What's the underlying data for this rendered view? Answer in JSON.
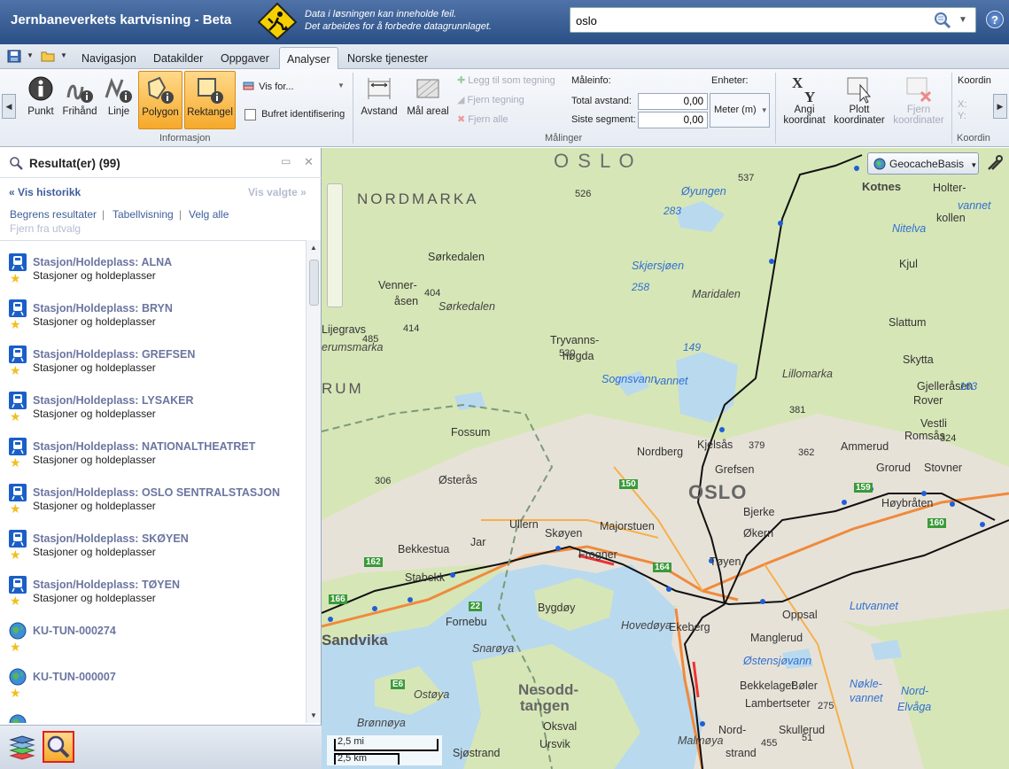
{
  "header": {
    "app_title": "Jernbaneverkets kartvisning - Beta",
    "warning_line1": "Data i løsningen kan inneholde feil.",
    "warning_line2": "Det arbeides for å forbedre datagrunnlaget.",
    "search_value": "oslo",
    "help_label": "?"
  },
  "tabs": [
    {
      "label": "Navigasjon"
    },
    {
      "label": "Datakilder"
    },
    {
      "label": "Oppgaver"
    },
    {
      "label": "Analyser"
    },
    {
      "label": "Norske tjenester"
    }
  ],
  "active_tab": "Analyser",
  "ribbon": {
    "informasjon": {
      "label": "Informasjon",
      "buttons": [
        {
          "label": "Punkt"
        },
        {
          "label": "Frihånd"
        },
        {
          "label": "Linje"
        },
        {
          "label": "Polygon"
        },
        {
          "label": "Rektangel"
        }
      ],
      "vis_for": "Vis for...",
      "bufret": "Bufret identifisering"
    },
    "malinger": {
      "label": "Målinger",
      "avstand": "Avstand",
      "mal_areal": "Mål areal",
      "legg_til": "Legg til som tegning",
      "fjern_tegning": "Fjern tegning",
      "fjern_alle": "Fjern alle",
      "maleinfo": "Måleinfo:",
      "enheter": "Enheter:",
      "total_label": "Total avstand:",
      "total_value": "0,00",
      "siste_label": "Siste segment:",
      "siste_value": "0,00",
      "unit": "Meter (m)"
    },
    "koordinater": {
      "label": "Koordin",
      "angi": [
        "Angi",
        "koordinat"
      ],
      "plott": [
        "Plott",
        "koordinater"
      ],
      "fjern": [
        "Fjern",
        "koordinater"
      ],
      "koordin_title": "Koordin",
      "x": "X:",
      "y": "Y:"
    }
  },
  "panel": {
    "title": "Resultat(er) (99)",
    "vis_historikk": "Vis historikk",
    "vis_valgte": "Vis valgte",
    "begrens": "Begrens resultater",
    "tabell": "Tabellvisning",
    "velg_alle": "Velg alle",
    "fjern": "Fjern fra utvalg",
    "results": [
      {
        "title": "Stasjon/Holdeplass: ALNA",
        "sub": "Stasjoner og holdeplasser",
        "icon": "train-icon"
      },
      {
        "title": "Stasjon/Holdeplass: BRYN",
        "sub": "Stasjoner og holdeplasser",
        "icon": "train-icon"
      },
      {
        "title": "Stasjon/Holdeplass: GREFSEN",
        "sub": "Stasjoner og holdeplasser",
        "icon": "train-icon"
      },
      {
        "title": "Stasjon/Holdeplass: LYSAKER",
        "sub": "Stasjoner og holdeplasser",
        "icon": "train-icon"
      },
      {
        "title": "Stasjon/Holdeplass: NATIONALTHEATRET",
        "sub": "Stasjoner og holdeplasser",
        "icon": "train-icon"
      },
      {
        "title": "Stasjon/Holdeplass: OSLO SENTRALSTASJON",
        "sub": "Stasjoner og holdeplasser",
        "icon": "train-icon"
      },
      {
        "title": "Stasjon/Holdeplass: SKØYEN",
        "sub": "Stasjoner og holdeplasser",
        "icon": "train-icon"
      },
      {
        "title": "Stasjon/Holdeplass: TØYEN",
        "sub": "Stasjoner og holdeplasser",
        "icon": "train-icon"
      },
      {
        "title": "KU-TUN-000274",
        "sub": "",
        "icon": "globe-icon"
      },
      {
        "title": "KU-TUN-000007",
        "sub": "",
        "icon": "globe-icon"
      }
    ]
  },
  "map": {
    "basemap": "GeocacheBasis",
    "scale_mi": "2,5 mi",
    "scale_km": "2,5 km",
    "labels": [
      {
        "t": "O S L O",
        "k": "big"
      },
      {
        "t": "NORDMARKA",
        "k": "region"
      },
      {
        "t": "Kotnes",
        "k": "place"
      },
      {
        "t": "Holter-",
        "k": "small"
      },
      {
        "t": "kollen",
        "k": "small"
      },
      {
        "t": "Nitelva",
        "k": "water"
      },
      {
        "t": "Kjul",
        "k": "small"
      },
      {
        "t": "Sørkedalen",
        "k": "small"
      },
      {
        "t": "Venner-",
        "k": "small"
      },
      {
        "t": "åsen",
        "k": "small"
      },
      {
        "t": "Sørkedalen",
        "k": "italic"
      },
      {
        "t": "Øyungen",
        "k": "water"
      },
      {
        "t": "Skjersjøen",
        "k": "water"
      },
      {
        "t": "Maridalen",
        "k": "italic"
      },
      {
        "t": "Tryvanns-",
        "k": "small"
      },
      {
        "t": "høgda",
        "k": "small"
      },
      {
        "t": "Sognsvann",
        "k": "water"
      },
      {
        "t": "Lillomarka",
        "k": "italic"
      },
      {
        "t": "Slattum",
        "k": "small"
      },
      {
        "t": "Skytta",
        "k": "small"
      },
      {
        "t": "Gjelleråsen",
        "k": "small"
      },
      {
        "t": "Rover",
        "k": "small"
      },
      {
        "t": "Romsås",
        "k": "small"
      },
      {
        "t": "Vestli",
        "k": "small"
      },
      {
        "t": "Ammerud",
        "k": "small"
      },
      {
        "t": "Grorud",
        "k": "small"
      },
      {
        "t": "Stovner",
        "k": "small"
      },
      {
        "t": "Fossum",
        "k": "small"
      },
      {
        "t": "Kjelsås",
        "k": "small"
      },
      {
        "t": "Nordberg",
        "k": "small"
      },
      {
        "t": "Grefsen",
        "k": "small"
      },
      {
        "t": "OSLO",
        "k": "city"
      },
      {
        "t": "Østerås",
        "k": "small"
      },
      {
        "t": "Bjerke",
        "k": "small"
      },
      {
        "t": "Økern",
        "k": "small"
      },
      {
        "t": "Høybråten",
        "k": "small"
      },
      {
        "t": "Ullern",
        "k": "small"
      },
      {
        "t": "Skøyen",
        "k": "small"
      },
      {
        "t": "Majorstuen",
        "k": "small"
      },
      {
        "t": "Frogner",
        "k": "small"
      },
      {
        "t": "Tøyen",
        "k": "small"
      },
      {
        "t": "Bekkestua",
        "k": "small"
      },
      {
        "t": "Jar",
        "k": "small"
      },
      {
        "t": "Stabekk",
        "k": "small"
      },
      {
        "t": "Fornebu",
        "k": "small"
      },
      {
        "t": "Bygdøy",
        "k": "small"
      },
      {
        "t": "Hovedøya",
        "k": "italic"
      },
      {
        "t": "Ekeberg",
        "k": "small"
      },
      {
        "t": "Oppsal",
        "k": "small"
      },
      {
        "t": "Lutvannet",
        "k": "water"
      },
      {
        "t": "Manglerud",
        "k": "small"
      },
      {
        "t": "Sandvika",
        "k": "town"
      },
      {
        "t": "Snarøya",
        "k": "italic"
      },
      {
        "t": "Østensjøvann",
        "k": "water"
      },
      {
        "t": "Bøler",
        "k": "small"
      },
      {
        "t": "Nøkle-",
        "k": "water"
      },
      {
        "t": "vannet",
        "k": "water"
      },
      {
        "t": "Nord-",
        "k": "water"
      },
      {
        "t": "Elvåga",
        "k": "water"
      },
      {
        "t": "Nesodd-",
        "k": "town2"
      },
      {
        "t": "tangen",
        "k": "town2"
      },
      {
        "t": "Ostøya",
        "k": "italic"
      },
      {
        "t": "Lambertseter",
        "k": "small"
      },
      {
        "t": "Skullerud",
        "k": "small"
      },
      {
        "t": "Bekkelaget",
        "k": "small"
      },
      {
        "t": "Nord-",
        "k": "small"
      },
      {
        "t": "strand",
        "k": "small"
      },
      {
        "t": "Oksval",
        "k": "small"
      },
      {
        "t": "Ursvik",
        "k": "small"
      },
      {
        "t": "Malmøya",
        "k": "italic"
      },
      {
        "t": "Brønnøya",
        "k": "italic"
      },
      {
        "t": "Sjøstrand",
        "k": "small"
      },
      {
        "t": "Lijegravs",
        "k": "small"
      },
      {
        "t": "erumsmarka",
        "k": "italic"
      },
      {
        "t": "RUM",
        "k": "region"
      },
      {
        "t": "526",
        "k": "num"
      },
      {
        "t": "537",
        "k": "num"
      },
      {
        "t": "283",
        "k": "waternum"
      },
      {
        "t": "258",
        "k": "waternum"
      },
      {
        "t": "404",
        "k": "num"
      },
      {
        "t": "414",
        "k": "num"
      },
      {
        "t": "485",
        "k": "num"
      },
      {
        "t": "530",
        "k": "num"
      },
      {
        "t": "149",
        "k": "waternum"
      },
      {
        "t": "381",
        "k": "num"
      },
      {
        "t": "379",
        "k": "num"
      },
      {
        "t": "362",
        "k": "num"
      },
      {
        "t": "324",
        "k": "num"
      },
      {
        "t": "306",
        "k": "num"
      },
      {
        "t": "150",
        "k": "road"
      },
      {
        "t": "159",
        "k": "road"
      },
      {
        "t": "160",
        "k": "road"
      },
      {
        "t": "162",
        "k": "road"
      },
      {
        "t": "164",
        "k": "road"
      },
      {
        "t": "166",
        "k": "road"
      },
      {
        "t": "22",
        "k": "road"
      },
      {
        "t": "163",
        "k": "waternum"
      },
      {
        "t": "275",
        "k": "num"
      },
      {
        "t": "51",
        "k": "num"
      },
      {
        "t": "E6",
        "k": "road"
      },
      {
        "t": "455",
        "k": "num"
      },
      {
        "t": "vannet",
        "k": "water"
      },
      {
        "t": "vannet",
        "k": "water"
      }
    ]
  },
  "colors": {
    "header_bg": "#2a4f86",
    "accent_orange": "#f6a92a",
    "link_blue": "#3f5e9a",
    "result_title": "#6b75a0",
    "map_forest": "#d7e6b7",
    "map_water": "#b9d9ee",
    "map_urban": "#e7e2d8",
    "rail": "#000000"
  }
}
